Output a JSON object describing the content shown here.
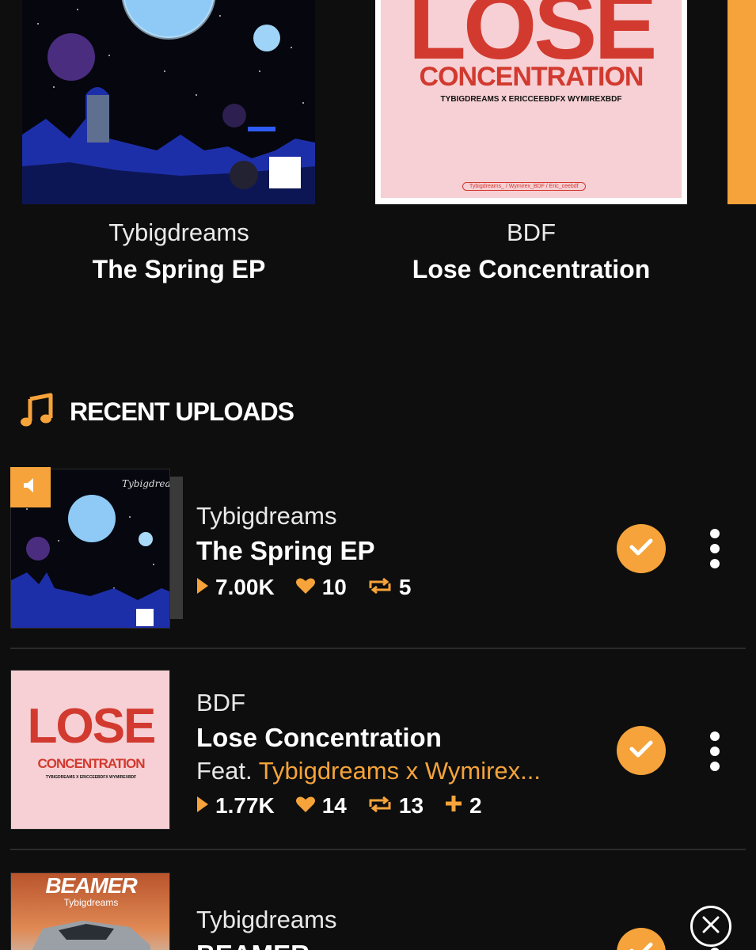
{
  "colors": {
    "accent": "#f5a33a",
    "background": "#0e0e0e",
    "text": "#ffffff"
  },
  "featured": [
    {
      "artist": "Tybigdreams",
      "title": "The Spring EP",
      "art": "night-sky-cemetery-artwork"
    },
    {
      "artist": "BDF",
      "title": "Lose Concentration",
      "art": "lose-concentration-artwork",
      "art_text": {
        "big": "LOSE",
        "sub": "CONCENTRATION",
        "credits": "TYBIGDREAMS X ERICCEEBDFX WYMIREXBDF",
        "handles": "Tybigdreams_ / Wymirex_BDF / Eric_ceebdf"
      }
    }
  ],
  "recent_uploads": {
    "icon": "music-note-icon",
    "title": "RECENT UPLOADS",
    "items": [
      {
        "artist": "Tybigdreams",
        "title": "The Spring EP",
        "plays": "7.00K",
        "likes": "10",
        "reposts": "5",
        "now_playing": true
      },
      {
        "artist": "BDF",
        "title": "Lose Concentration",
        "feat_label": "Feat.",
        "feat_names": "Tybigdreams x Wymirex...",
        "plays": "1.77K",
        "likes": "14",
        "reposts": "13",
        "adds": "2"
      },
      {
        "artist": "Tybigdreams",
        "title": "BEAMER",
        "art_text": {
          "big": "BEAMER",
          "sub": "Tybigdreams"
        }
      }
    ]
  }
}
